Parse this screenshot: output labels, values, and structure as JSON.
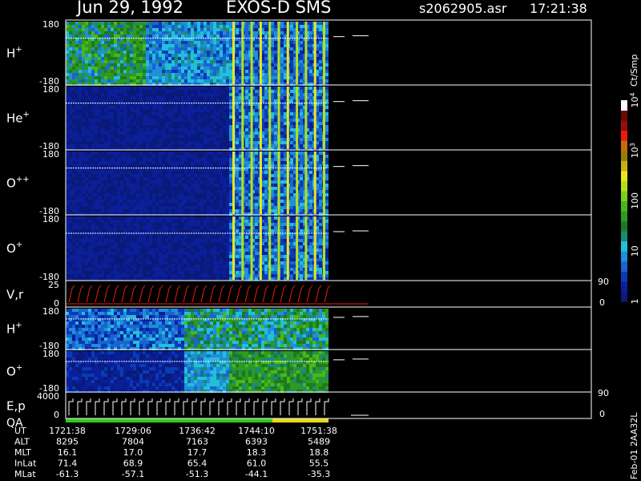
{
  "header": {
    "date": "Jun 29, 1992",
    "instrument": "EXOS-D SMS",
    "file": "s2062905.asr",
    "time": "17:21:38"
  },
  "chart_data": {
    "type": "heatmap",
    "panels": [
      {
        "label": "H",
        "sup": "+",
        "ymin_label": "-180",
        "ymax_label": "180",
        "kind": "spec1"
      },
      {
        "label": "He",
        "sup": "+",
        "ymin_label": "-180",
        "ymax_label": "180",
        "kind": "spec2"
      },
      {
        "label": "O",
        "sup": "++",
        "ymin_label": "-180",
        "ymax_label": "180",
        "kind": "spec2"
      },
      {
        "label": "O",
        "sup": "+",
        "ymin_label": "-180",
        "ymax_label": "180",
        "kind": "spec2"
      },
      {
        "label": "V,r",
        "sup": "",
        "ymin_label": "0",
        "ymax_label": "25",
        "right_min": "0",
        "right_max": "90",
        "kind": "line_vr"
      },
      {
        "label": "H",
        "sup": "+",
        "ymin_label": "-180",
        "ymax_label": "180",
        "kind": "spec3"
      },
      {
        "label": "O",
        "sup": "+",
        "ymin_label": "-180",
        "ymax_label": "180",
        "kind": "spec4"
      },
      {
        "label": "E,p",
        "sup": "",
        "label2": "QA",
        "ymin_label": "0",
        "ymax_label": "4000",
        "right_min": "0",
        "right_max": "90",
        "kind": "line_ep"
      }
    ],
    "colorbar": {
      "unit": "Ct/Smp",
      "ticks": [
        {
          "text": "1",
          "exp": "",
          "value": 1
        },
        {
          "text": "10",
          "exp": "",
          "value": 10
        },
        {
          "text": "100",
          "exp": "",
          "value": 100
        },
        {
          "text": "10",
          "exp": "3",
          "value": 1000
        },
        {
          "text": "10",
          "exp": "4",
          "value": 10000
        }
      ],
      "colors": [
        "#0a1a7a",
        "#0a1f98",
        "#0a3ab8",
        "#1a64d0",
        "#1e8fd8",
        "#22c0d8",
        "#1a8a78",
        "#1e7a20",
        "#2e9a1e",
        "#4ab61c",
        "#7ad01c",
        "#b4e01a",
        "#e8e81a",
        "#c8b014",
        "#9a7a0c",
        "#c86a08",
        "#e81c0c",
        "#9a0c08",
        "#6a0a06",
        "#ffffff"
      ]
    },
    "time_ticks": [
      "1721:38",
      "1729:06",
      "1736:42",
      "1744:10",
      "1751:38"
    ],
    "orbit_rows": [
      {
        "label": "UT",
        "values": [
          "1721:38",
          "1729:06",
          "1736:42",
          "1744:10",
          "1751:38"
        ]
      },
      {
        "label": "ALT",
        "values": [
          "8295",
          "7804",
          "7163",
          "6393",
          "5489"
        ]
      },
      {
        "label": "MLT",
        "values": [
          "16.1",
          "17.0",
          "17.7",
          "18.3",
          "18.8"
        ]
      },
      {
        "label": "InLat",
        "values": [
          "71.4",
          "68.9",
          "65.4",
          "61.0",
          "55.5"
        ]
      },
      {
        "label": "MLat",
        "values": [
          "-61.3",
          "-57.1",
          "-51.3",
          "-44.1",
          "-35.3"
        ]
      }
    ],
    "footer_stamp": "Feb-01 2AA32L"
  }
}
